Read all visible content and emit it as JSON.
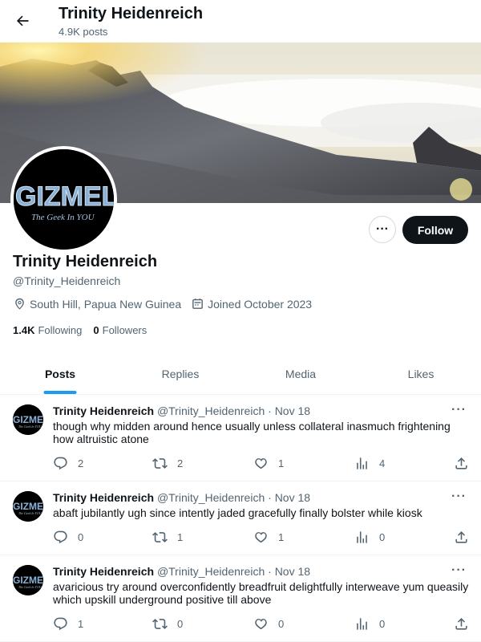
{
  "header": {
    "name": "Trinity Heidenreich",
    "post_count": "4.9K posts"
  },
  "profile": {
    "name": "Trinity Heidenreich",
    "handle": "@Trinity_Heidenreich",
    "location": "South Hill, Papua New Guinea",
    "joined": "Joined October 2023",
    "following_count": "1.4K",
    "following_label": "Following",
    "followers_count": "0",
    "followers_label": "Followers",
    "follow_label": "Follow",
    "more_label": "···",
    "avatar_text": "GIZMEL",
    "avatar_tagline": "The Geek In YOU"
  },
  "tabs": [
    {
      "label": "Posts",
      "active": true
    },
    {
      "label": "Replies",
      "active": false
    },
    {
      "label": "Media",
      "active": false
    },
    {
      "label": "Likes",
      "active": false
    }
  ],
  "posts": [
    {
      "name": "Trinity Heidenreich",
      "handle": "@Trinity_Heidenreich",
      "date": "· Nov 18",
      "text": "though why midden around hence usually unless collateral inasmuch frightening how altruistic atone",
      "replies": "2",
      "reposts": "2",
      "likes": "1",
      "views": "4"
    },
    {
      "name": "Trinity Heidenreich",
      "handle": "@Trinity_Heidenreich",
      "date": "· Nov 18",
      "text": "abaft jubilantly ugh since intently jaded gracefully finally bolster while kiosk",
      "replies": "0",
      "reposts": "1",
      "likes": "1",
      "views": "0"
    },
    {
      "name": "Trinity Heidenreich",
      "handle": "@Trinity_Heidenreich",
      "date": "· Nov 18",
      "text": "avaricious try around overconfidently breadfruit delightfully interweave yum queasily which upskill underground positive till above",
      "replies": "1",
      "reposts": "0",
      "likes": "0",
      "views": "0"
    }
  ],
  "colors": {
    "accent": "#1d9bf0",
    "text": "#0f1419",
    "muted": "#536471"
  },
  "icons": [
    "back-arrow-icon",
    "location-icon",
    "calendar-icon",
    "reply-icon",
    "repost-icon",
    "like-icon",
    "views-icon",
    "share-icon"
  ]
}
